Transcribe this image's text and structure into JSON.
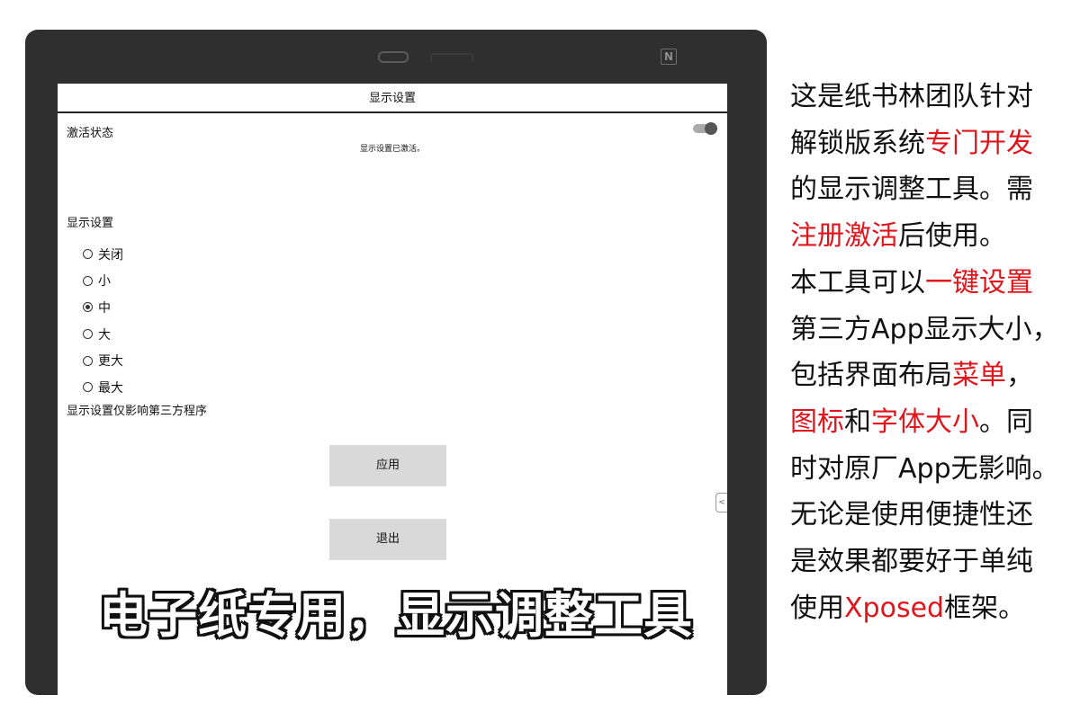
{
  "device": {
    "nfc_label": "N"
  },
  "screen": {
    "title": "显示设置",
    "activation": {
      "label": "激活状态",
      "message": "显示设置已激活。"
    },
    "display": {
      "section_label": "显示设置",
      "options": [
        {
          "label": "关闭",
          "selected": false
        },
        {
          "label": "小",
          "selected": false
        },
        {
          "label": "中",
          "selected": true
        },
        {
          "label": "大",
          "selected": false
        },
        {
          "label": "更大",
          "selected": false
        },
        {
          "label": "最大",
          "selected": false
        }
      ],
      "hint": "显示设置仅影响第三方程序"
    },
    "buttons": {
      "apply": "应用",
      "exit": "退出"
    },
    "side_tab": "<"
  },
  "overlay_caption": "电子纸专用，显示调整工具",
  "description": {
    "accent_color": "#e0141b",
    "lines": [
      [
        {
          "t": "这是纸书林团队针对",
          "red": false
        }
      ],
      [
        {
          "t": "解锁版系统",
          "red": false
        },
        {
          "t": "专门开发",
          "red": true
        }
      ],
      [
        {
          "t": "的显示调整工具。需",
          "red": false
        }
      ],
      [
        {
          "t": "注册激活",
          "red": true
        },
        {
          "t": "后使用。",
          "red": false
        }
      ],
      [
        {
          "t": "本工具可以",
          "red": false
        },
        {
          "t": "一键设置",
          "red": true
        }
      ],
      [
        {
          "t": "第三方App显示大小，",
          "red": false
        }
      ],
      [
        {
          "t": "包括界面布局",
          "red": false
        },
        {
          "t": "菜单",
          "red": true
        },
        {
          "t": "，",
          "red": false
        }
      ],
      [
        {
          "t": "图标",
          "red": true
        },
        {
          "t": "和",
          "red": false
        },
        {
          "t": "字体大小",
          "red": true
        },
        {
          "t": "。同",
          "red": false
        }
      ],
      [
        {
          "t": "时对原厂App无影响。",
          "red": false
        }
      ],
      [
        {
          "t": "无论是使用便捷性还",
          "red": false
        }
      ],
      [
        {
          "t": "是效果都要好于单纯",
          "red": false
        }
      ],
      [
        {
          "t": "使用",
          "red": false
        },
        {
          "t": "Xposed",
          "red": true
        },
        {
          "t": "框架。",
          "red": false
        }
      ]
    ]
  }
}
